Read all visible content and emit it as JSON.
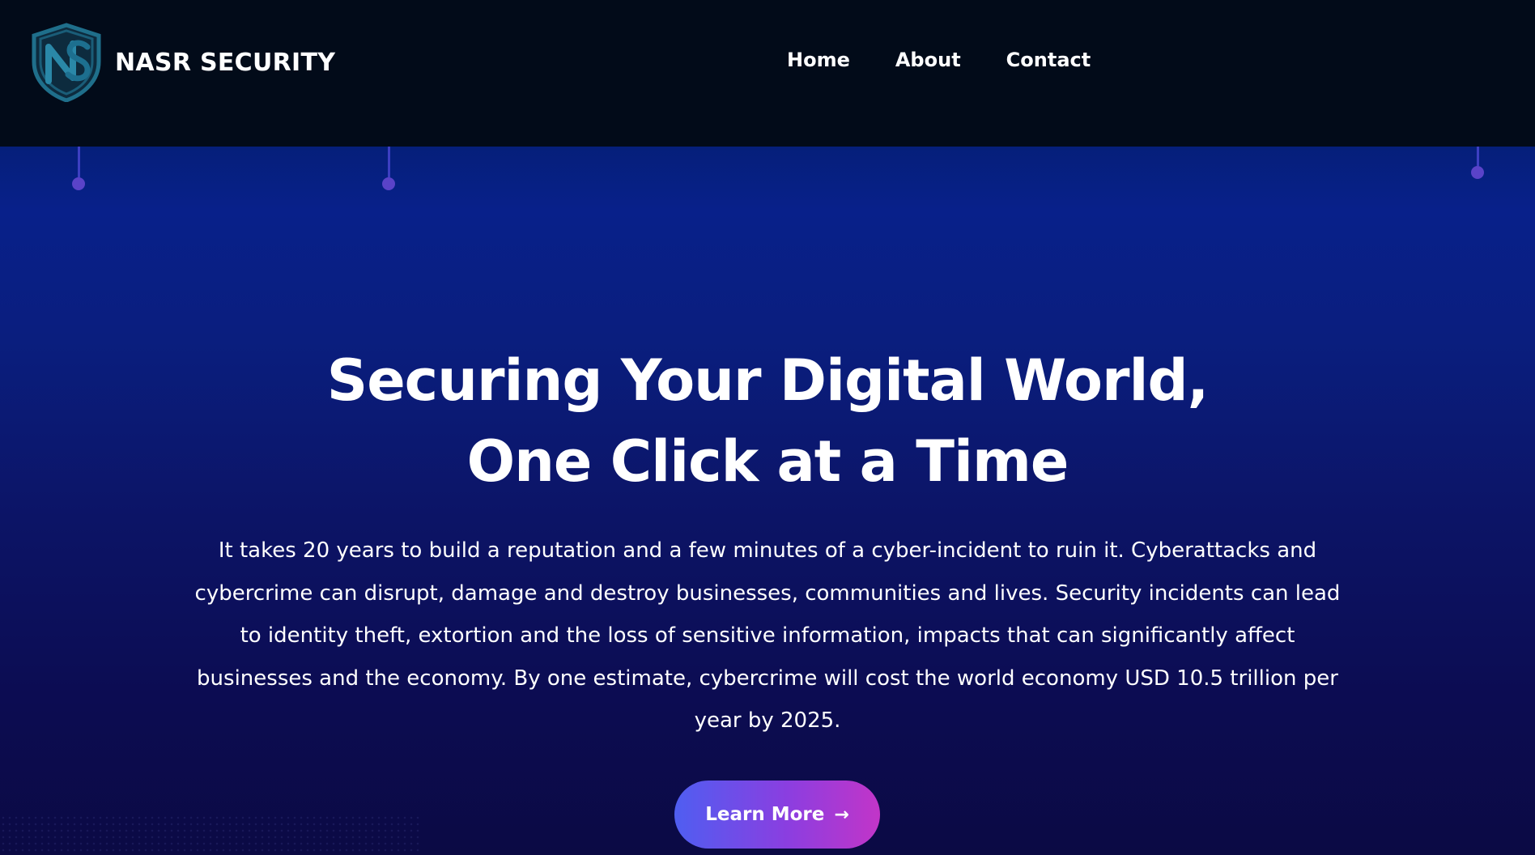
{
  "header": {
    "brand_name": "NASR SECURITY",
    "logo_icon": "shield-ns-icon",
    "nav": [
      {
        "label": "Home"
      },
      {
        "label": "About"
      },
      {
        "label": "Contact"
      }
    ]
  },
  "hero": {
    "title_line1": "Securing Your Digital World,",
    "title_line2": "One Click at a Time",
    "description": "It takes 20 years to build a reputation and a few minutes of a cyber-incident to ruin it. Cyberattacks and cybercrime can disrupt, damage and destroy businesses, communities and lives. Security incidents can lead to identity theft, extortion and the loss of sensitive information, impacts that can significantly affect businesses and the economy. By one estimate, cybercrime will cost the world economy USD 10.5 trillion per year by 2025.",
    "cta_label": "Learn More",
    "cta_icon": "arrow-icon"
  },
  "colors": {
    "navbar_bg": "#020b19",
    "hero_bg_top": "#051f7a",
    "hero_bg_bottom": "#0b0a44",
    "cta_gradient_start": "#4f5ef1",
    "cta_gradient_end": "#c235c8",
    "logo_accent": "#1f6f8b"
  }
}
